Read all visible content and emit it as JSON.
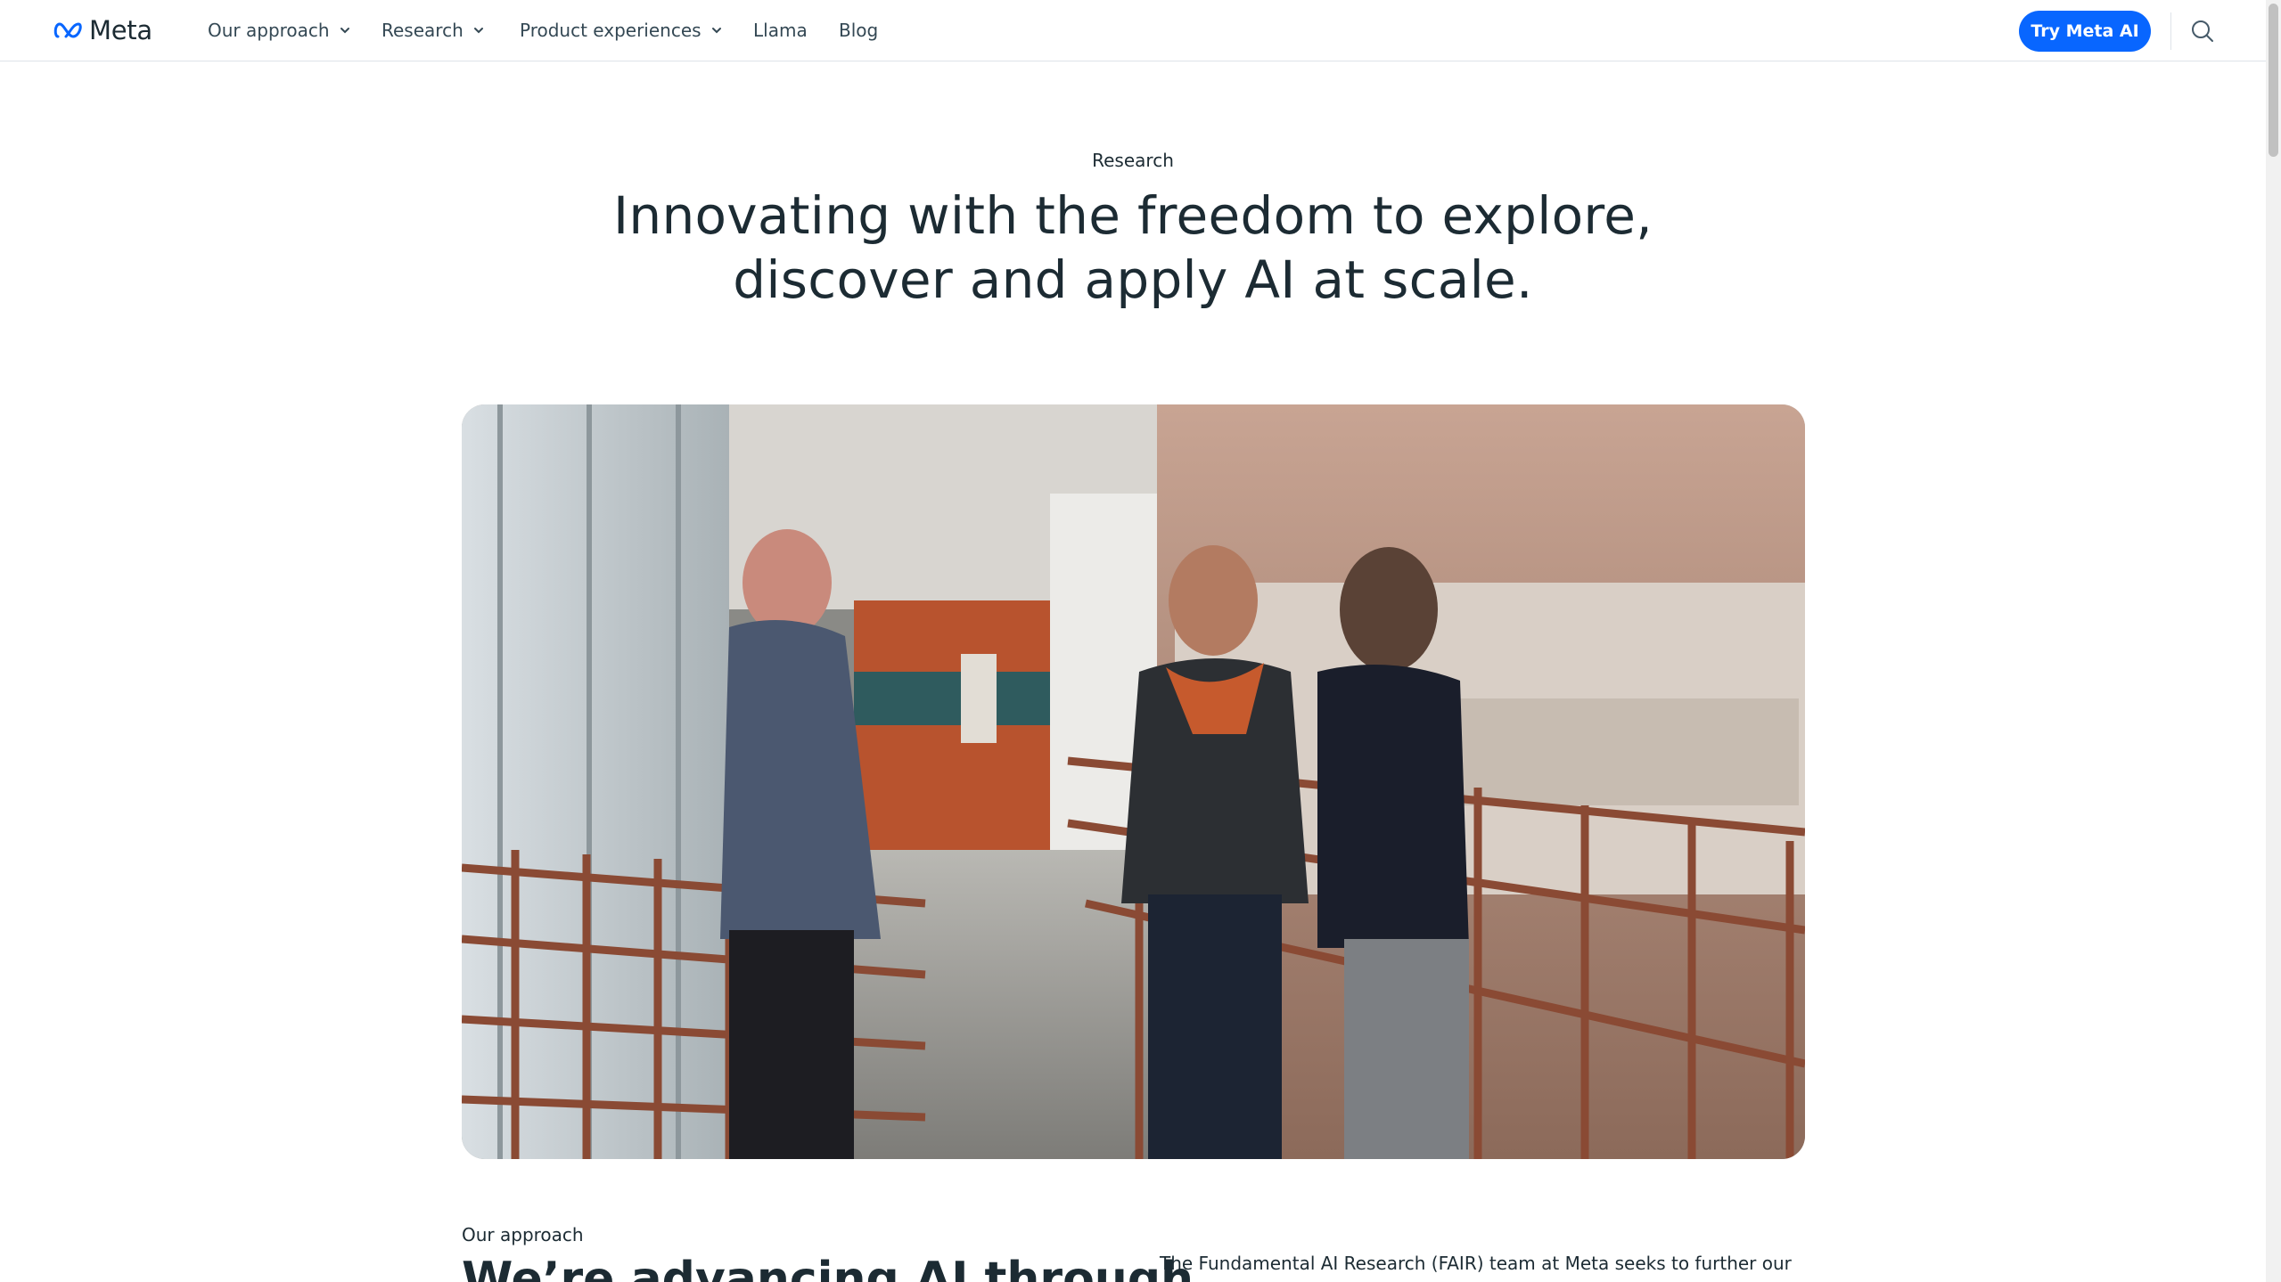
{
  "header": {
    "logo_text": "Meta",
    "nav": [
      {
        "label": "Our approach",
        "has_dropdown": true
      },
      {
        "label": "Research",
        "has_dropdown": true
      },
      {
        "label": "Product experiences",
        "has_dropdown": true
      },
      {
        "label": "Llama",
        "has_dropdown": false
      },
      {
        "label": "Blog",
        "has_dropdown": false
      }
    ],
    "cta_label": "Try Meta AI",
    "search_icon": "search-icon"
  },
  "hero": {
    "eyebrow": "Research",
    "title_line1": "Innovating with the freedom to explore,",
    "title_line2": "discover and apply AI at scale."
  },
  "approach": {
    "eyebrow": "Our approach",
    "heading": "We’re advancing AI through",
    "body": "The Fundamental AI Research (FAIR) team at Meta seeks to further our"
  },
  "colors": {
    "accent": "#0866ff",
    "text": "#1c2b33",
    "divider": "#dee3e9"
  }
}
